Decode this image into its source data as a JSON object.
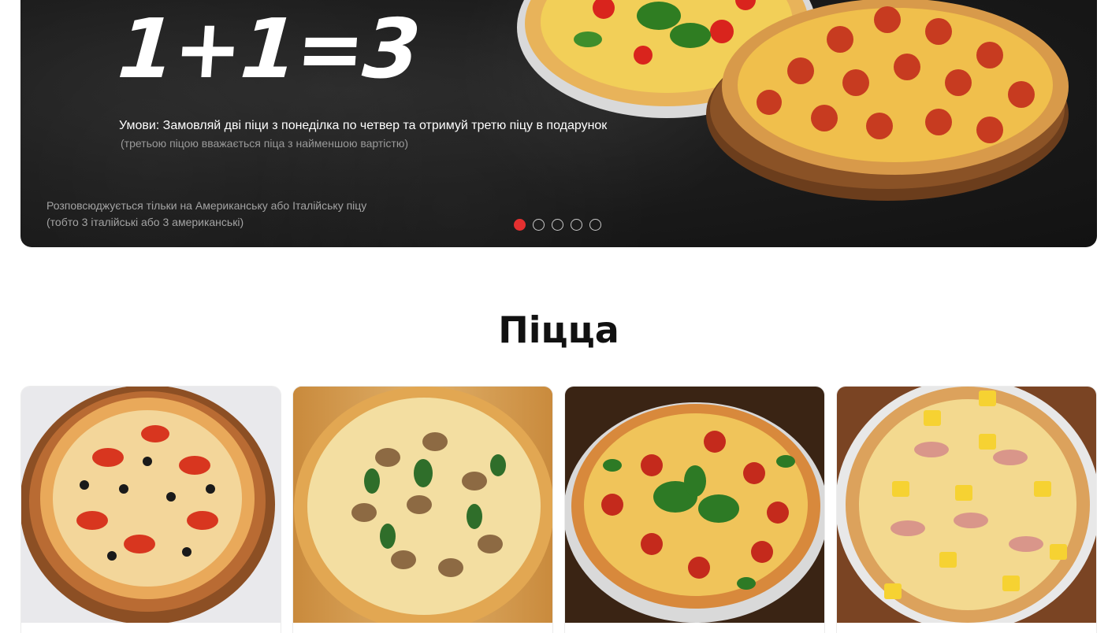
{
  "banner": {
    "title": "1+1=3",
    "conditions": "Умови: Замовляй дві піци з понеділка по четвер та отримуй третю піцу в подарунок",
    "note": "(третьою піцою вважається піца з найменшою вартістю)",
    "scope_line1": "Розповсюджується тільки на Американську або Італійську піцу",
    "scope_line2": "(тобто 3 італійські або 3 американські)",
    "slides_total": 5,
    "active_slide": 1,
    "accent_color": "#e53030"
  },
  "section": {
    "title": "Піцца"
  },
  "cards": [
    {
      "image": "pizza-vegetable-icon"
    },
    {
      "image": "pizza-mushroom-icon"
    },
    {
      "image": "pizza-salami-basil-icon"
    },
    {
      "image": "pizza-hawaiian-icon"
    }
  ]
}
